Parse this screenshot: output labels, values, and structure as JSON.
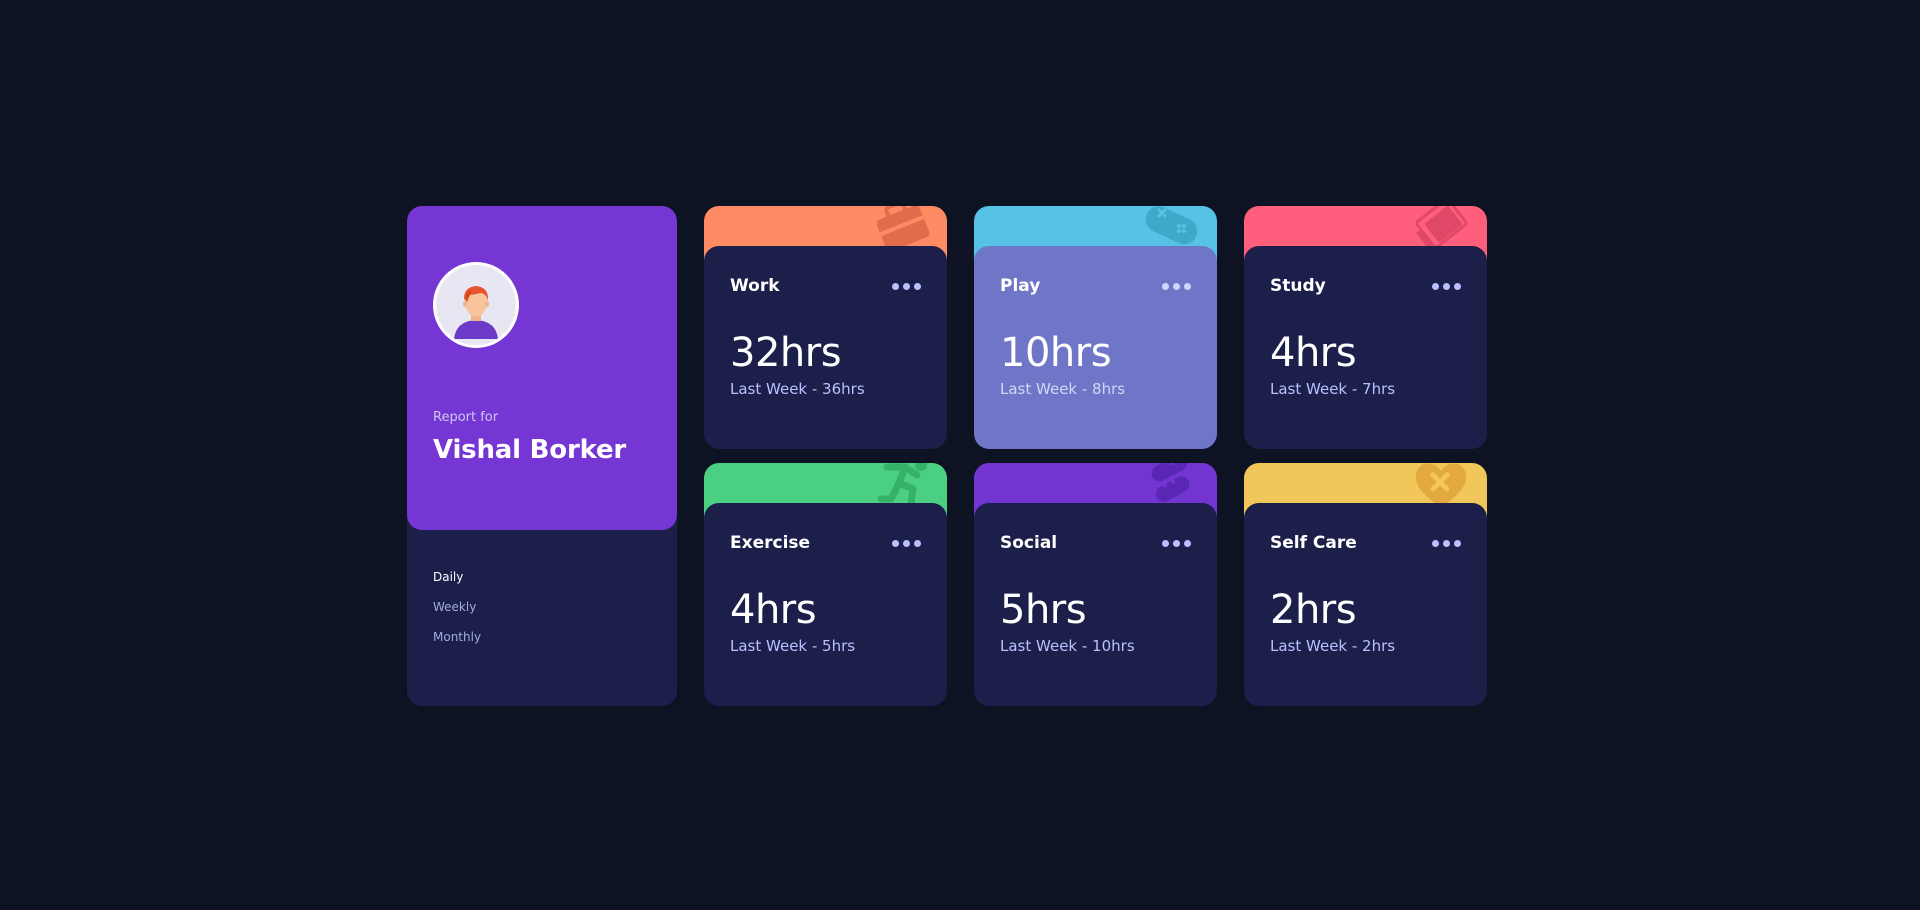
{
  "profile": {
    "report_for": "Report for",
    "name": "Vishal Borker",
    "periods": [
      {
        "label": "Daily",
        "active": true
      },
      {
        "label": "Weekly",
        "active": false
      },
      {
        "label": "Monthly",
        "active": false
      }
    ]
  },
  "cards": [
    {
      "title": "Work",
      "hours": "32hrs",
      "previous": "Last Week - 36hrs",
      "color": "#ff8b64",
      "icon": "briefcase-icon"
    },
    {
      "title": "Play",
      "hours": "10hrs",
      "previous": "Last Week - 8hrs",
      "color": "#55c2e6",
      "icon": "gamepad-icon"
    },
    {
      "title": "Study",
      "hours": "4hrs",
      "previous": "Last Week - 7hrs",
      "color": "#ff5e7d",
      "icon": "book-icon"
    },
    {
      "title": "Exercise",
      "hours": "4hrs",
      "previous": "Last Week - 5hrs",
      "color": "#4bcf82",
      "icon": "running-icon"
    },
    {
      "title": "Social",
      "hours": "5hrs",
      "previous": "Last Week - 10hrs",
      "color": "#7335d2",
      "icon": "social-icon"
    },
    {
      "title": "Self Care",
      "hours": "2hrs",
      "previous": "Last Week - 2hrs",
      "color": "#f1c75b",
      "icon": "heart-care-icon"
    }
  ],
  "colors": {
    "background": "#0d1323",
    "card": "#1c1f4a",
    "card_highlight": "#6f76c8",
    "profile": "#7536d3"
  }
}
